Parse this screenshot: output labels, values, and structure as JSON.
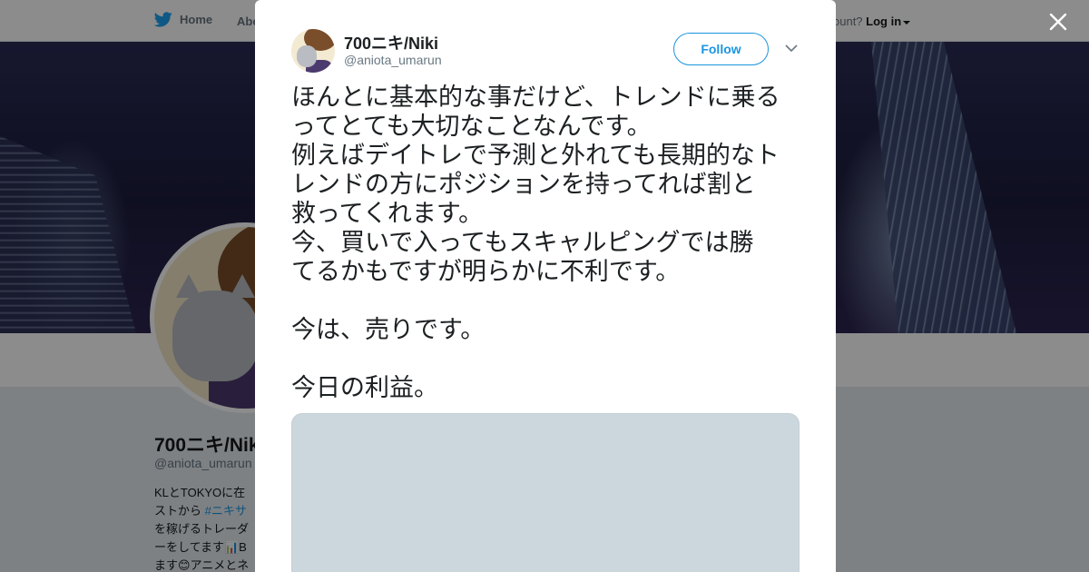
{
  "nav": {
    "home_label": "Home",
    "about_label": "Abo",
    "login_prompt": "ccount?",
    "login_label": "Log in"
  },
  "profile": {
    "name": "700ニキ/Niki",
    "handle": "@aniota_umarun",
    "bio_lines": [
      {
        "text": "KLとTOKYOに在",
        "hashtag": ""
      },
      {
        "text": "ストから ",
        "hashtag": "#ニキサ"
      },
      {
        "text": "を稼げるトレーダ",
        "hashtag": ""
      },
      {
        "text": "ーをしてます📊B",
        "hashtag": ""
      },
      {
        "text": "ます😊アニメとネ",
        "hashtag": ""
      }
    ]
  },
  "tweet": {
    "author_name": "700ニキ/Niki",
    "author_handle": "@aniota_umarun",
    "follow_label": "Follow",
    "lines": [
      "ほんとに基本的な事だけど、トレンドに乗る",
      "ってとても大切なことなんです。",
      "例えばデイトレで予測と外れても長期的なト",
      "レンドの方にポジションを持ってれば割と",
      "救ってくれます。",
      "今、買いで入ってもスキャルピングでは勝",
      "てるかもですが明らかに不利です。",
      "",
      "今は、売りです。",
      "",
      "今日の利益。"
    ]
  },
  "colors": {
    "accent": "#1b95e0",
    "text_primary": "#1c2022",
    "text_secondary": "#697882",
    "overlay": "rgba(0,0,0,0.45)",
    "media_placeholder": "#ccd6dd"
  },
  "icons": {
    "nav_home": "bird-icon",
    "close": "close-icon",
    "menu": "chevron-down-icon",
    "login_menu": "caret-down-icon"
  }
}
